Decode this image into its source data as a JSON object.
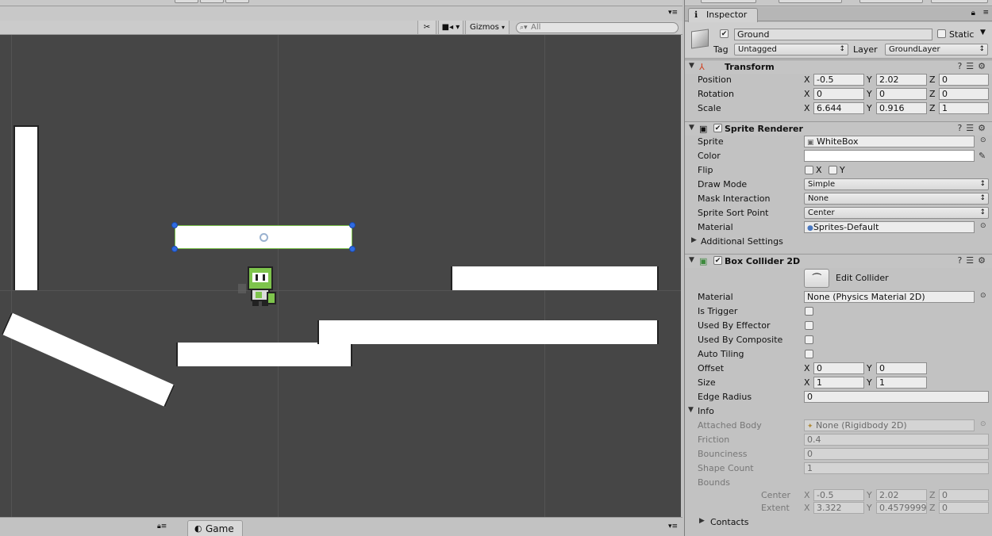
{
  "scene": {
    "gizmos_label": "Gizmos",
    "search_placeholder": "All",
    "game_tab_label": "Game"
  },
  "inspector": {
    "tab_label": "Inspector",
    "object": {
      "name": "Ground",
      "active": true,
      "static_label": "Static",
      "static_checked": false,
      "tag_label": "Tag",
      "tag_value": "Untagged",
      "layer_label": "Layer",
      "layer_value": "GroundLayer"
    },
    "transform": {
      "title": "Transform",
      "position_label": "Position",
      "rotation_label": "Rotation",
      "scale_label": "Scale",
      "position": {
        "x": "-0.5",
        "y": "2.02",
        "z": "0"
      },
      "rotation": {
        "x": "0",
        "y": "0",
        "z": "0"
      },
      "scale": {
        "x": "6.644",
        "y": "0.916",
        "z": "1"
      },
      "x_label": "X",
      "y_label": "Y",
      "z_label": "Z"
    },
    "sprite_renderer": {
      "title": "Sprite Renderer",
      "enabled": true,
      "sprite_label": "Sprite",
      "sprite_value": "WhiteBox",
      "color_label": "Color",
      "color_value": "#ffffff",
      "flip_label": "Flip",
      "flip_x_label": "X",
      "flip_y_label": "Y",
      "draw_mode_label": "Draw Mode",
      "draw_mode_value": "Simple",
      "mask_label": "Mask Interaction",
      "mask_value": "None",
      "sort_point_label": "Sprite Sort Point",
      "sort_point_value": "Center",
      "material_label": "Material",
      "material_value": "Sprites-Default",
      "additional_label": "Additional Settings"
    },
    "box_collider": {
      "title": "Box Collider 2D",
      "enabled": true,
      "edit_collider_label": "Edit Collider",
      "material_label": "Material",
      "material_value": "None (Physics Material 2D)",
      "is_trigger_label": "Is Trigger",
      "used_by_effector_label": "Used By Effector",
      "used_by_composite_label": "Used By Composite",
      "auto_tiling_label": "Auto Tiling",
      "offset_label": "Offset",
      "offset": {
        "x": "0",
        "y": "0"
      },
      "size_label": "Size",
      "size": {
        "x": "1",
        "y": "1"
      },
      "edge_radius_label": "Edge Radius",
      "edge_radius_value": "0"
    },
    "info": {
      "title": "Info",
      "attached_body_label": "Attached Body",
      "attached_body_value": "None (Rigidbody 2D)",
      "friction_label": "Friction",
      "friction_value": "0.4",
      "bounciness_label": "Bounciness",
      "bounciness_value": "0",
      "shape_count_label": "Shape Count",
      "shape_count_value": "1",
      "bounds_label": "Bounds",
      "center_label": "Center",
      "center": {
        "x": "-0.5",
        "y": "2.02",
        "z": "0"
      },
      "extent_label": "Extent",
      "extent": {
        "x": "3.322",
        "y": "0.4579999",
        "z": "0"
      },
      "contacts_label": "Contacts"
    }
  }
}
